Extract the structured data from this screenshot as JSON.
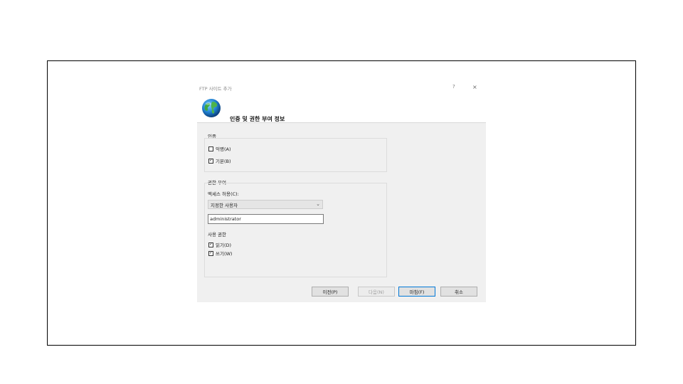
{
  "dialog": {
    "title": "FTP 사이트 추가",
    "help_label": "?",
    "close_label": "×",
    "header_title": "인증 및 권한 부여 정보"
  },
  "authentication": {
    "group_label": "인증",
    "anonymous": {
      "label": "익명(A)",
      "checked": false
    },
    "basic": {
      "label": "기본(B)",
      "checked": true
    }
  },
  "authorization": {
    "group_label": "권한 부여",
    "access_label": "액세스 허용(C):",
    "access_selected": "지정한 사용자",
    "user_value": "administrator",
    "permissions_label": "사용 권한",
    "read": {
      "label": "읽기(D)",
      "checked": true
    },
    "write": {
      "label": "쓰기(W)",
      "checked": true
    }
  },
  "footer": {
    "prev_label": "이전(P)",
    "next_label": "다음(N)",
    "finish_label": "마침(F)",
    "cancel_label": "취소"
  },
  "colors": {
    "body_bg": "#f0f0f0",
    "accent": "#0078d7"
  },
  "icons": {
    "header": "globe-icon",
    "combo": "chevron-down-icon",
    "close": "close-icon"
  }
}
